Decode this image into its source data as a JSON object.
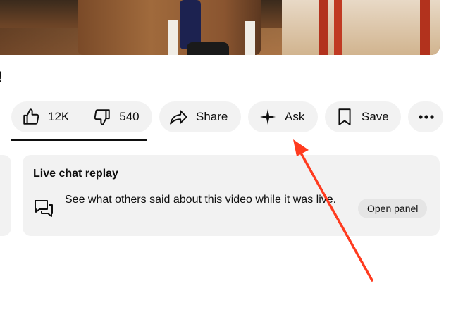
{
  "title_fragment": "!",
  "actions": {
    "like_count": "12K",
    "dislike_count": "540",
    "share_label": "Share",
    "ask_label": "Ask",
    "save_label": "Save",
    "more_icon": "more-horizontal-icon"
  },
  "live_chat": {
    "title": "Live chat replay",
    "description": "See what others said about this video while it was live.",
    "open_panel_label": "Open panel",
    "icon": "chat-bubbles-icon"
  },
  "annotation": {
    "arrow_color": "#ff3b1f"
  }
}
